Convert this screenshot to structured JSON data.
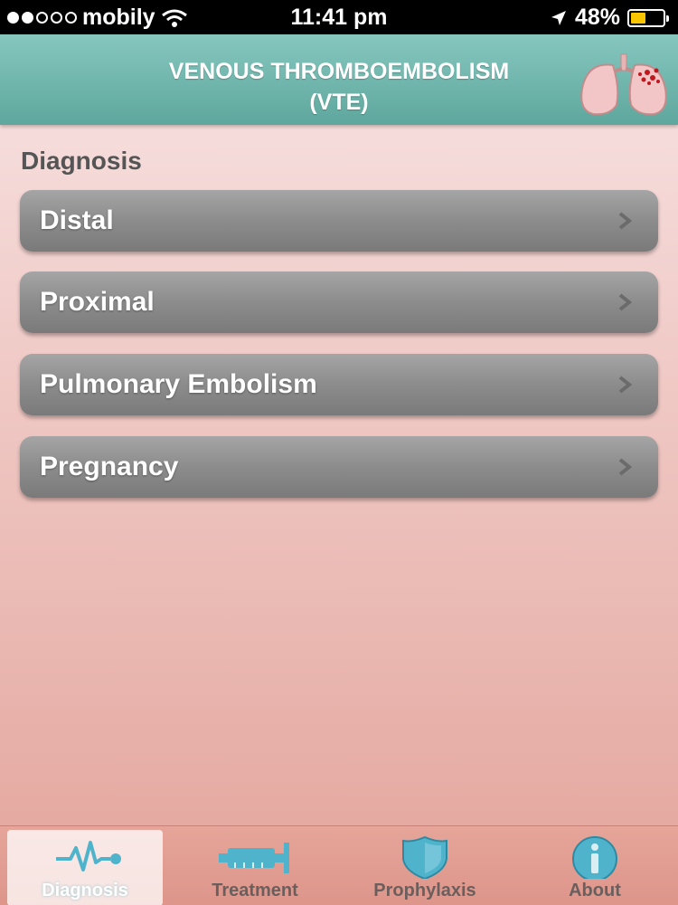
{
  "status_bar": {
    "carrier": "mobily",
    "time": "11:41 pm",
    "battery_percent": "48%",
    "battery_level": 0.48,
    "signal_bars": 2,
    "signal_total": 5
  },
  "header": {
    "title_line1": "VENOUS THROMBOEMBOLISM",
    "title_line2": "(VTE)",
    "logo_icon": "lungs-icon"
  },
  "section": {
    "title": "Diagnosis"
  },
  "menu": [
    {
      "label": "Distal"
    },
    {
      "label": "Proximal"
    },
    {
      "label": "Pulmonary Embolism"
    },
    {
      "label": "Pregnancy"
    }
  ],
  "tabs": [
    {
      "label": "Diagnosis",
      "icon": "pulse-icon",
      "active": true
    },
    {
      "label": "Treatment",
      "icon": "syringe-icon",
      "active": false
    },
    {
      "label": "Prophylaxis",
      "icon": "shield-icon",
      "active": false
    },
    {
      "label": "About",
      "icon": "info-icon",
      "active": false
    }
  ],
  "colors": {
    "header": "#6fb5ac",
    "menu_button": "#8c8c8c",
    "tab_icon": "#4fb3cc",
    "battery": "#f7c600"
  }
}
